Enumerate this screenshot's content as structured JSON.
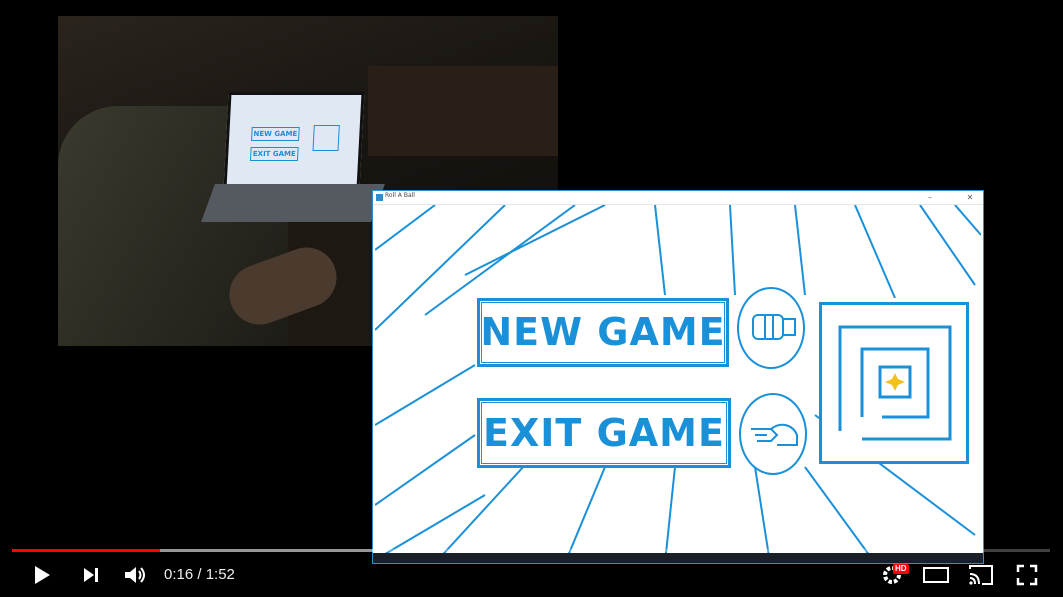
{
  "webcam": {
    "mini_new_game": "NEW GAME",
    "mini_exit_game": "EXIT GAME"
  },
  "game_window": {
    "title": "Roll A Ball",
    "min_glyph": "–",
    "close_glyph": "✕",
    "new_game_label": "NEW GAME",
    "exit_game_label": "EXIT GAME"
  },
  "player": {
    "time_display": "0:16 / 1:52",
    "progress_fraction": 0.143,
    "buffered_fraction": 0.35,
    "hd_badge": "HD",
    "icons": [
      "play-icon",
      "next-icon",
      "volume-icon",
      "settings-icon",
      "theater-mode-icon",
      "cast-icon",
      "fullscreen-icon"
    ]
  },
  "colors": {
    "accent": "#1a90d8",
    "progress": "#ff0000"
  }
}
